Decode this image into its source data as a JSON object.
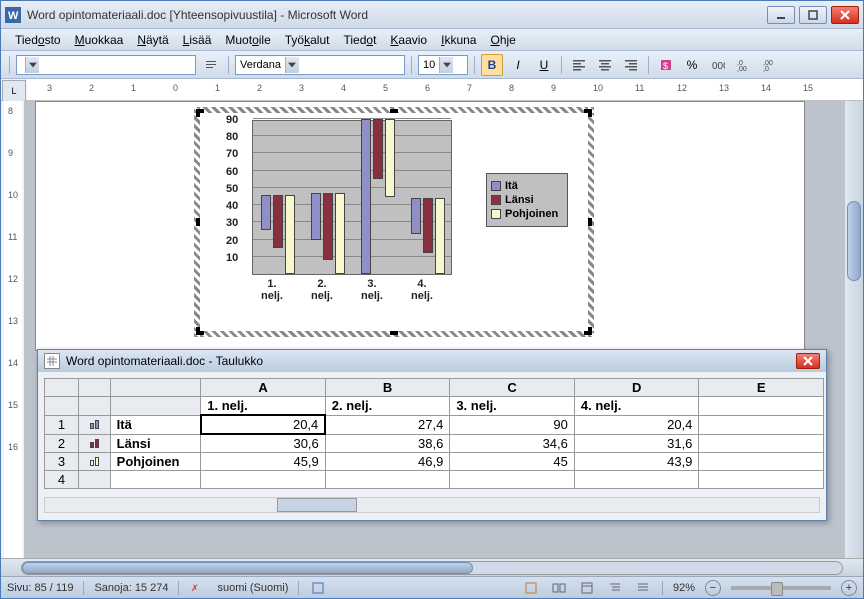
{
  "window": {
    "title": "Word opintomateriaali.doc [Yhteensopivuustila] - Microsoft Word"
  },
  "menu": {
    "items": [
      "Tiedosto",
      "Muokkaa",
      "Näytä",
      "Lisää",
      "Muotoile",
      "Työkalut",
      "Tiedot",
      "Kaavio",
      "Ikkuna",
      "Ohje"
    ],
    "hotkeys": [
      4,
      0,
      0,
      0,
      4,
      3,
      4,
      0,
      0,
      0
    ]
  },
  "toolbar": {
    "style_combo": "",
    "font_combo": "Verdana",
    "size_combo": "10",
    "bold": "B",
    "italic": "I",
    "underline": "U"
  },
  "chart_data": {
    "type": "bar",
    "categories": [
      "1. nelj.",
      "2. nelj.",
      "3. nelj.",
      "4. nelj."
    ],
    "series": [
      {
        "name": "Itä",
        "color": "#9090c8",
        "values": [
          20.4,
          27.4,
          90,
          20.4
        ]
      },
      {
        "name": "Länsi",
        "color": "#883040",
        "values": [
          30.6,
          38.6,
          34.6,
          31.6
        ]
      },
      {
        "name": "Pohjoinen",
        "color": "#f8f8d0",
        "values": [
          45.9,
          46.9,
          45,
          43.9
        ]
      }
    ],
    "ylim": [
      0,
      90
    ],
    "yticks": [
      10,
      20,
      30,
      40,
      50,
      60,
      70,
      80,
      90
    ]
  },
  "datasheet": {
    "title": "Word opintomateriaali.doc - Taulukko",
    "col_headers": [
      "A",
      "B",
      "C",
      "D",
      "E"
    ],
    "quarter_labels": [
      "1. nelj.",
      "2. nelj.",
      "3. nelj.",
      "4. nelj.",
      ""
    ],
    "rows": [
      {
        "num": "1",
        "label": "Itä",
        "color": "#9090c8",
        "vals": [
          "20,4",
          "27,4",
          "90",
          "20,4",
          ""
        ]
      },
      {
        "num": "2",
        "label": "Länsi",
        "color": "#883040",
        "vals": [
          "30,6",
          "38,6",
          "34,6",
          "31,6",
          ""
        ]
      },
      {
        "num": "3",
        "label": "Pohjoinen",
        "color": "#f8f8d0",
        "vals": [
          "45,9",
          "46,9",
          "45",
          "43,9",
          ""
        ]
      },
      {
        "num": "4",
        "label": "",
        "color": "",
        "vals": [
          "",
          "",
          "",
          "",
          ""
        ]
      }
    ]
  },
  "statusbar": {
    "page": "Sivu: 85 / 119",
    "words": "Sanoja: 15 274",
    "lang": "suomi (Suomi)",
    "zoom": "92%"
  }
}
